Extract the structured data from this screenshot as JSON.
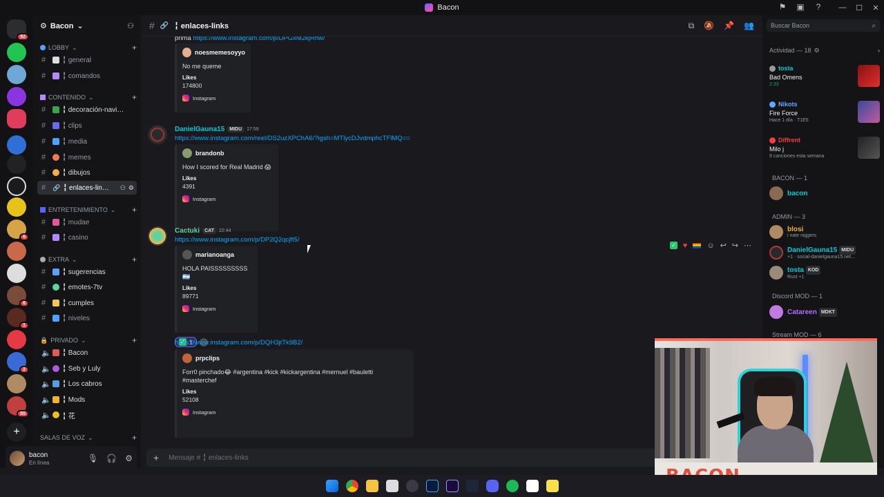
{
  "window": {
    "title": "Bacon"
  },
  "server": {
    "name": "Bacon"
  },
  "categories": {
    "lobby": "LOBBY",
    "contenido": "CONTENIDO",
    "entretenimiento": "ENTRETENIMIENTO",
    "extra": "EXTRA",
    "privado": "PRIVADO",
    "voz": "SALAS DE VOZ"
  },
  "channels": {
    "general": "╏ general",
    "comandos": "╏ comandos",
    "decoracion": "╏ decoración-navi…",
    "clips": "╏ clips",
    "media": "╏ media",
    "memes": "╏ memes",
    "dibujos": "╏ dibujos",
    "enlaces": "╏ enlaces-lin…",
    "mudae": "╏ mudae",
    "casino": "╏ casino",
    "sugerencias": "╏ sugerencias",
    "emotes": "╏ emotes-7tv",
    "cumples": "╏ cumples",
    "niveles": "╏ niveles",
    "bacon": "╏ Bacon",
    "seb": "╏ Seb y Luly",
    "cabros": "╏ Los cabros",
    "mods": "╏ Mods",
    "hana": "╏ 花"
  },
  "user": {
    "name": "bacon",
    "status": "En línea"
  },
  "header": {
    "channel": "╏ enlaces-links",
    "search_placeholder": "Buscar Bacon"
  },
  "messages": {
    "top_link": "https://www.instagram.com/p/DPGxM2kjRhw/",
    "top_embed": {
      "author": "noesmemesoyyo",
      "desc": "No me queme",
      "likes_label": "Likes",
      "likes": "174800",
      "footer": "Instagram"
    },
    "m1": {
      "author": "DanielGauna15",
      "tag": "MIDU",
      "time": "17:59",
      "link": "https://www.instagram.com/reel/DS2uzXPChA6/?igsh=MTlycDJvdmphcTFlMQ==",
      "embed": {
        "author": "brandonb",
        "desc": "How I scored for Real Madrid 😱",
        "likes_label": "Likes",
        "likes": "4391",
        "footer": "Instagram"
      }
    },
    "m2": {
      "author": "Cactuki",
      "tag": "CAT",
      "time": "22:44",
      "link": "https://www.instagram.com/p/DP2Q2qcjft5/",
      "embed": {
        "author": "marianoanga",
        "desc": "HOLA PAISSSSSSSSS 🇦🇷",
        "likes_label": "Likes",
        "likes": "89771",
        "footer": "Instagram"
      },
      "reaction_count": "1"
    },
    "m3": {
      "link": "https://www.instagram.com/p/DQH3jtTk9B2/",
      "embed": {
        "author": "prpclips",
        "desc": "Forr0 pinchado😂 #argentina #kick #kickargentina #mernuel #bauletti #masterchef",
        "likes_label": "Likes",
        "likes": "52108",
        "footer": "Instagram"
      }
    }
  },
  "composer": {
    "placeholder": "Mensaje #  ╏ enlaces-links"
  },
  "activity": {
    "header": "Actividad — 18",
    "items": [
      {
        "user": "tosta",
        "title": "Bad Omens",
        "sub": "2:33",
        "color": "#00c8d7"
      },
      {
        "user": "Nikots",
        "title": "Fire Force",
        "sub": "Hace 1 día · T1E5",
        "color": "#5fa8ff"
      },
      {
        "user": "Diffrent",
        "title": "Milo j",
        "sub": "9 canciones esta semana",
        "color": "#f23f43"
      }
    ]
  },
  "members": {
    "bacon_group": "BACON — 1",
    "bacon_user": "bacon",
    "admin_group": "ADMIN — 3",
    "admins": [
      {
        "name": "blosi",
        "status": "i nate niggers",
        "color": "#f0b232"
      },
      {
        "name": "DanielGauna15",
        "tag": "MIDU",
        "status": "+1 · social-danielgauna15.net…",
        "color": "#00c8d7"
      },
      {
        "name": "tosta",
        "tag": "KOD",
        "status": "Rust +1",
        "color": "#00c8d7"
      }
    ],
    "discord_mod_group": "Discord MOD — 1",
    "mod": {
      "name": "Catareen",
      "tag": "MDKT",
      "color": "#b56cff"
    },
    "stream_mod_group": "Stream MOD — 6"
  },
  "webcam": {
    "banner": "BACON"
  },
  "colors": {
    "link": "#00a8fc",
    "accent": "#5865f2",
    "background": "#1a1a1e"
  }
}
